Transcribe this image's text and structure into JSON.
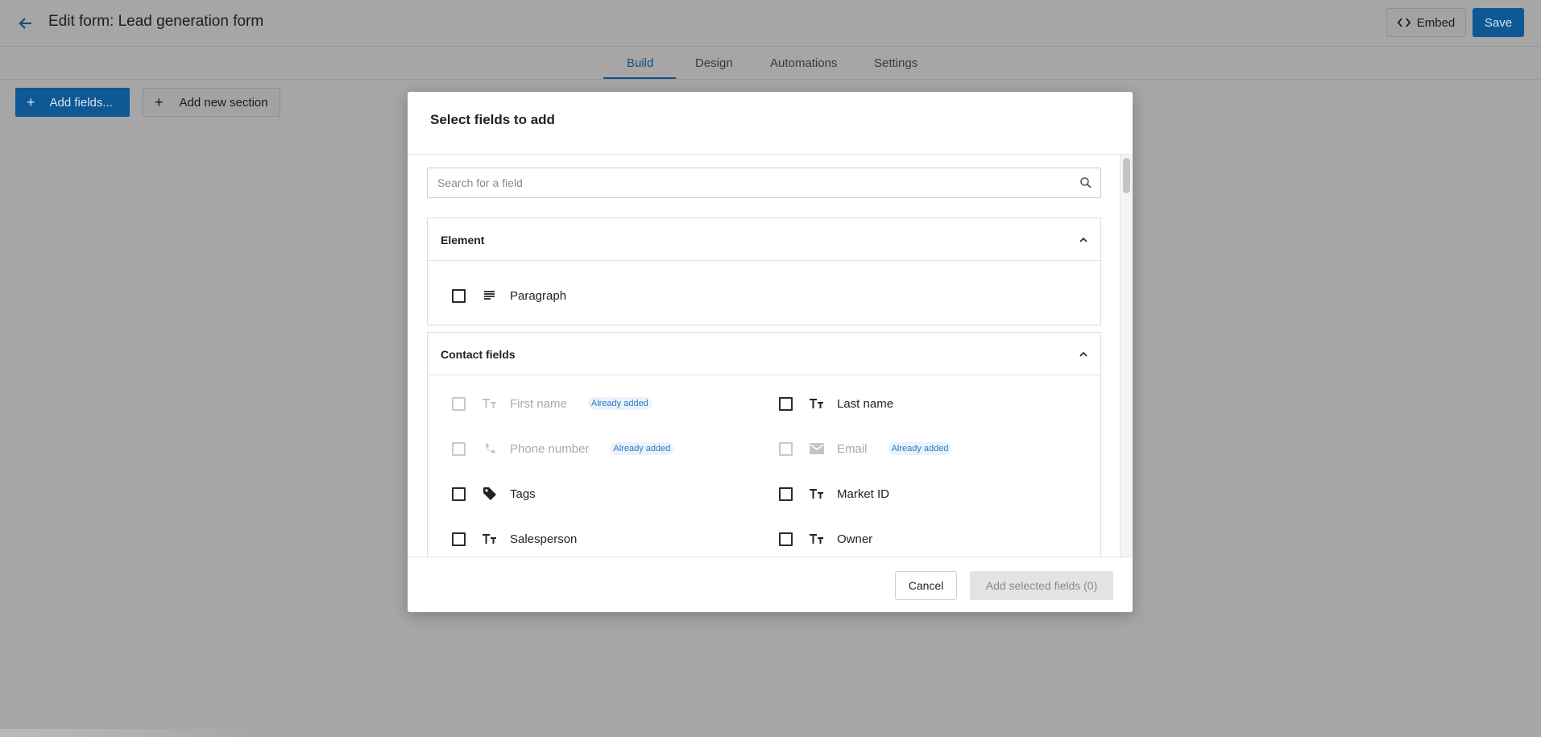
{
  "header": {
    "title": "Edit form: Lead generation form",
    "embed_label": "Embed",
    "save_label": "Save"
  },
  "tabs": [
    {
      "label": "Build",
      "active": true
    },
    {
      "label": "Design",
      "active": false
    },
    {
      "label": "Automations",
      "active": false
    },
    {
      "label": "Settings",
      "active": false
    }
  ],
  "toolbar": {
    "add_fields_label": "Add fields...",
    "add_section_label": "Add new section"
  },
  "modal": {
    "title": "Select fields to add",
    "search_placeholder": "Search for a field",
    "sections": [
      {
        "title": "Element",
        "fields": [
          {
            "label": "Paragraph",
            "icon": "paragraph-icon",
            "disabled": false
          }
        ]
      },
      {
        "title": "Contact fields",
        "fields": [
          {
            "label": "First name",
            "icon": "text-field-icon",
            "disabled": true,
            "badge": "Already added"
          },
          {
            "label": "Last name",
            "icon": "text-field-icon",
            "disabled": false
          },
          {
            "label": "Phone number",
            "icon": "phone-icon",
            "disabled": true,
            "badge": "Already added"
          },
          {
            "label": "Email",
            "icon": "email-icon",
            "disabled": true,
            "badge": "Already added"
          },
          {
            "label": "Tags",
            "icon": "tag-icon",
            "disabled": false
          },
          {
            "label": "Market ID",
            "icon": "text-field-icon",
            "disabled": false
          },
          {
            "label": "Salesperson",
            "icon": "text-field-icon",
            "disabled": false
          },
          {
            "label": "Owner",
            "icon": "text-field-icon",
            "disabled": false
          }
        ]
      }
    ],
    "cancel_label": "Cancel",
    "add_selected_label": "Add selected fields (0)"
  },
  "colors": {
    "primary": "#0e5896",
    "overlay": "#a6a6a6",
    "badge_text": "#2f7bc4",
    "badge_bg": "#eaf3fb"
  }
}
